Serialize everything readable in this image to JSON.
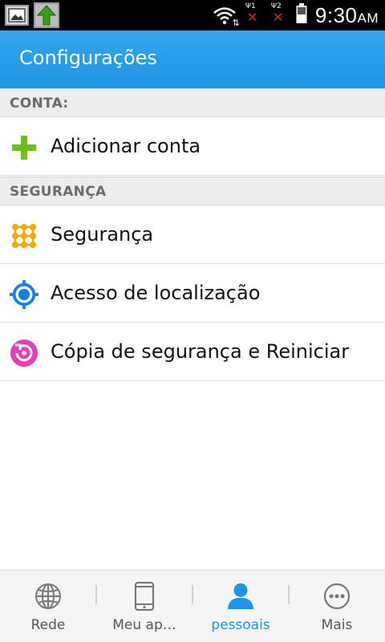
{
  "status_bar": {
    "time": "9:30",
    "ampm": "AM",
    "sim1_label": "Ψ1",
    "sim2_label": "Ψ2",
    "no_signal_mark": "✕"
  },
  "header": {
    "title": "Configurações"
  },
  "sections": [
    {
      "title": "CONTA:",
      "items": [
        {
          "label": "Adicionar conta",
          "icon": "plus-icon"
        }
      ]
    },
    {
      "title": "SEGURANÇA",
      "items": [
        {
          "label": "Segurança",
          "icon": "pattern-grid-icon"
        },
        {
          "label": "Acesso de localização",
          "icon": "location-target-icon"
        },
        {
          "label": "Cópia de segurança e Reiniciar",
          "icon": "backup-restore-icon"
        }
      ]
    }
  ],
  "bottom_nav": {
    "active": 2,
    "items": [
      {
        "label": "Rede",
        "icon": "globe-icon"
      },
      {
        "label": "Meu ap…",
        "icon": "phone-icon"
      },
      {
        "label": "pessoais",
        "icon": "person-icon"
      },
      {
        "label": "Mais",
        "icon": "more-icon"
      }
    ]
  },
  "colors": {
    "accent": "#1e95e6",
    "action_bar": "#2a9eeb",
    "plus_icon": "#6cc11b",
    "pattern_icon": "#f5a900",
    "location_icon": "#1a7fe0",
    "backup_icon": "#e53fb6"
  }
}
